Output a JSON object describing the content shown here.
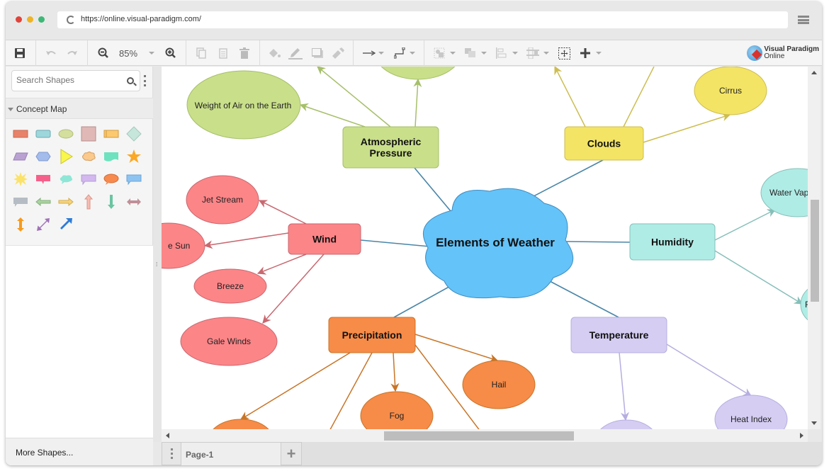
{
  "browser": {
    "url": "https://online.visual-paradigm.com/"
  },
  "toolbar": {
    "zoom_level": "85%",
    "logo_line1": "Visual Paradigm",
    "logo_line2": "Online",
    "buttons": [
      "save",
      "undo",
      "redo",
      "zoom-out",
      "zoom-level",
      "zoom-in",
      "copy",
      "paste",
      "delete",
      "fill-color",
      "line-color",
      "shadow",
      "format-painter",
      "connector-style",
      "waypoint-style",
      "arrange",
      "group",
      "align",
      "distribute",
      "select-all",
      "insert"
    ]
  },
  "sidebar": {
    "search_placeholder": "Search Shapes",
    "category": "Concept Map",
    "shapes": [
      {
        "name": "rectangle",
        "color": "#e8836a"
      },
      {
        "name": "rounded-rectangle",
        "color": "#9dd7dc"
      },
      {
        "name": "ellipse",
        "color": "#d4df9e"
      },
      {
        "name": "square",
        "color": "#e0b9b7"
      },
      {
        "name": "process",
        "color": "#fcc96f"
      },
      {
        "name": "diamond",
        "color": "#c6e6dc"
      },
      {
        "name": "parallelogram",
        "color": "#b9a2d2"
      },
      {
        "name": "hexagon",
        "color": "#a4bcec"
      },
      {
        "name": "triangle",
        "color": "#f9f64c"
      },
      {
        "name": "cloud",
        "color": "#fbc98c"
      },
      {
        "name": "document",
        "color": "#6ee2be"
      },
      {
        "name": "star",
        "color": "#fba825"
      },
      {
        "name": "explosion",
        "color": "#fbe36a"
      },
      {
        "name": "callout-rect",
        "color": "#f5608a"
      },
      {
        "name": "callout-cloud",
        "color": "#8ee6d6"
      },
      {
        "name": "callout-rect-purple",
        "color": "#d3b8ef"
      },
      {
        "name": "callout-oval",
        "color": "#f88a4e"
      },
      {
        "name": "callout-blue",
        "color": "#8dc3f1"
      },
      {
        "name": "callout-gray",
        "color": "#b6bcc4"
      },
      {
        "name": "arrow-left",
        "color": "#a9d3a0"
      },
      {
        "name": "arrow-right",
        "color": "#f7d37a"
      },
      {
        "name": "arrow-up",
        "color": "#f8bcb0"
      },
      {
        "name": "arrow-down",
        "color": "#6cc4a2"
      },
      {
        "name": "arrow-left-right",
        "color": "#c08f98"
      },
      {
        "name": "arrow-up-down",
        "color": "#f79a1c"
      },
      {
        "name": "arrow-diagonal-both",
        "color": "#a072b7"
      },
      {
        "name": "arrow-diagonal",
        "color": "#2d7bd7"
      }
    ],
    "more_shapes": "More Shapes..."
  },
  "pages": {
    "tabs": [
      "Page-1"
    ]
  },
  "diagram": {
    "central": {
      "label": "Elements of Weather",
      "color": "#64c3f8"
    },
    "topics": [
      {
        "id": "atm",
        "label_lines": [
          "Atmospheric",
          "Pressure"
        ],
        "color": "#c9df8a",
        "stroke": "#a6bf6a"
      },
      {
        "id": "clouds",
        "label_lines": [
          "Clouds"
        ],
        "color": "#f4e465",
        "stroke": "#cdbd50"
      },
      {
        "id": "wind",
        "label_lines": [
          "Wind"
        ],
        "color": "#fc8588",
        "stroke": "#c86870"
      },
      {
        "id": "humidity",
        "label_lines": [
          "Humidity"
        ],
        "color": "#b0ece6",
        "stroke": "#86bfb9"
      },
      {
        "id": "precip",
        "label_lines": [
          "Precipitation"
        ],
        "color": "#f78b48",
        "stroke": "#c87528"
      },
      {
        "id": "temp",
        "label_lines": [
          "Temperature"
        ],
        "color": "#d5cdf2",
        "stroke": "#b6aee0"
      }
    ],
    "leaves": [
      {
        "parent": "atm",
        "label": "Weight of Air on the Earth"
      },
      {
        "parent": "atm",
        "label": ""
      },
      {
        "parent": "clouds",
        "label": "Cirrus"
      },
      {
        "parent": "wind",
        "label": "Jet Stream"
      },
      {
        "parent": "wind",
        "label": "e Sun"
      },
      {
        "parent": "wind",
        "label": "Breeze"
      },
      {
        "parent": "wind",
        "label": "Gale Winds"
      },
      {
        "parent": "humidity",
        "label": "Water Vapor"
      },
      {
        "parent": "humidity",
        "label": "Re"
      },
      {
        "parent": "precip",
        "label": "Hail"
      },
      {
        "parent": "precip",
        "label": "Fog"
      },
      {
        "parent": "precip",
        "label": ""
      },
      {
        "parent": "temp",
        "label": "Heat Index"
      },
      {
        "parent": "temp",
        "label": ""
      }
    ]
  }
}
